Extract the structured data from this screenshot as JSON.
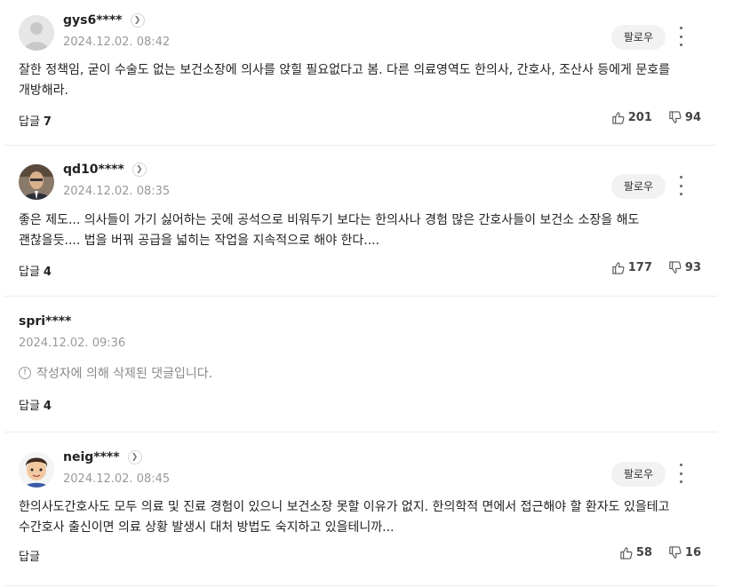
{
  "follow_label": "팔로우",
  "reply_label": "답글",
  "comments": [
    {
      "nickname": "gys6****",
      "date": "2024.12.02. 08:42",
      "text": "잘한 정책임, 굳이 수술도 없는 보건소장에 의사를 앉힐 필요없다고 봄. 다른 의료영역도 한의사, 간호사, 조산사 등에게 문호를 개방해라.",
      "reply_count": "7",
      "likes": "201",
      "dislikes": "94"
    },
    {
      "nickname": "qd10****",
      "date": "2024.12.02. 08:35",
      "text": "좋은 제도... 의사들이 가기 싫어하는 곳에 공석으로 비워두기 보다는 한의사나 경험 많은 간호사들이 보건소 소장을 해도 괜찮을듯.... 법을 버꿔 공급을 넓히는 작업을 지속적으로 해야 한다....",
      "reply_count": "4",
      "likes": "177",
      "dislikes": "93"
    },
    {
      "nickname": "spri****",
      "date": "2024.12.02. 09:36",
      "deleted_text": "작성자에 의해 삭제된 댓글입니다.",
      "reply_count": "4"
    },
    {
      "nickname": "neig****",
      "date": "2024.12.02. 08:45",
      "text": "한의사도간호사도 모두 의료 및 진료 경험이 있으니 보건소장 못할 이유가 없지. 한의학적 면에서 접근해야 할 환자도 있을테고 수간호사 출신이면 의료 상황 발생시 대처 방법도 숙지하고 있을테니까...",
      "reply_count": "",
      "likes": "58",
      "dislikes": "16"
    }
  ]
}
